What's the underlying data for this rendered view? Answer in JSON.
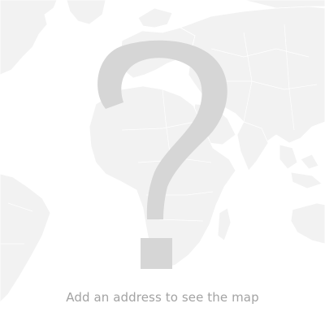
{
  "map_placeholder": {
    "icon": "question-mark-icon",
    "background_icon": "world-map-icon",
    "message": "Add an address to see the map"
  },
  "colors": {
    "background": "#ffffff",
    "landmass": "#f2f2f2",
    "borders": "#ffffff",
    "question_mark": "#d6d6d6",
    "message_text": "#a3a3a3"
  }
}
